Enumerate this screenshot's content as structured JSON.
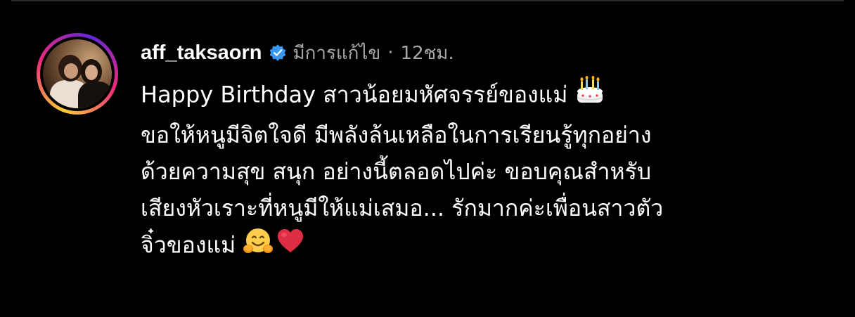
{
  "comment": {
    "username": "aff_taksaorn",
    "edited_label": "มีการแก้ไข",
    "separator": "·",
    "time": "12ชม.",
    "lines": [
      "Happy Birthday สาวน้อยมหัศจรรย์ของแม่",
      "ขอให้หนูมีจิตใจดี มีพลังล้นเหลือในการเรียนรู้ทุกอย่าง",
      "ด้วยความสุข สนุก อย่างนี้ตลอดไปค่ะ ขอบคุณสำหรับ",
      "เสียงหัวเราะที่หนูมีให้แม่เสมอ... รักมากค่ะเพื่อนสาวตัว",
      "จิ๋วของแม่"
    ],
    "emojis": {
      "line1": "birthday-cake-icon",
      "line5": [
        "hugging-face-icon",
        "red-heart-icon"
      ]
    }
  },
  "colors": {
    "background": "#000000",
    "text": "#ffffff",
    "meta": "#a8a8a8",
    "verified": "#3897f0"
  },
  "icons": {
    "verified": "verified-badge-icon",
    "avatar": "profile-avatar"
  }
}
